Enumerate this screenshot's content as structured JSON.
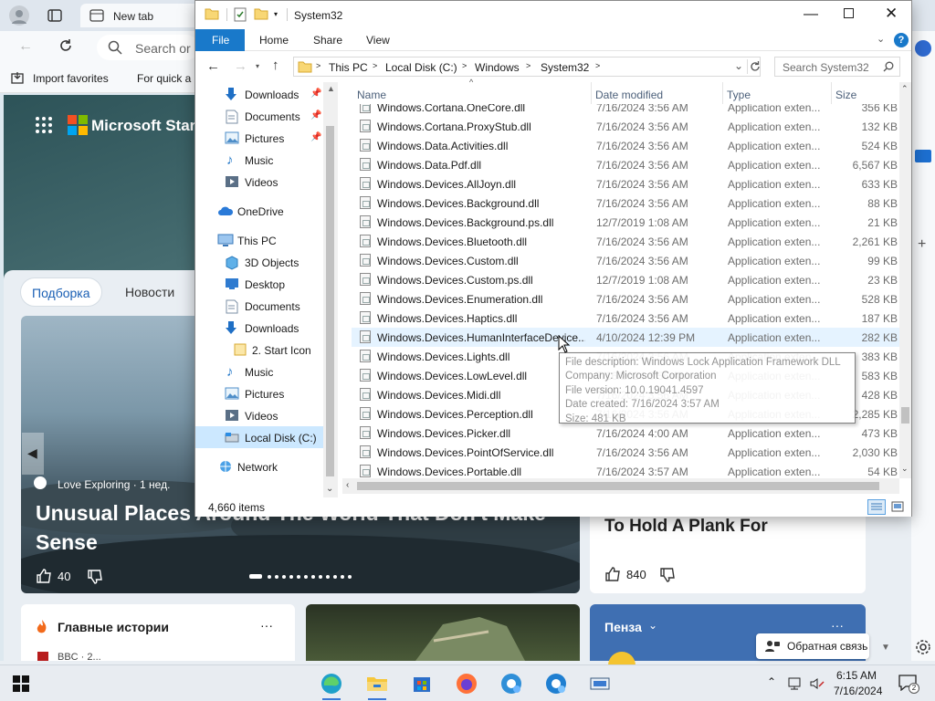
{
  "edge": {
    "tab_title": "New tab",
    "search_placeholder": "Search or",
    "favorites": [
      "Import favorites",
      "For quick a"
    ],
    "ms_start": "Microsoft Start",
    "pills": [
      "Подборка",
      "Новости"
    ],
    "big_card": {
      "source": "Love Exploring · 1 нед.",
      "title": "Unusual Places Around The World That Don't Make Sense",
      "likes": "40"
    },
    "right_card": {
      "title": "To Hold A Plank For",
      "likes": "840"
    },
    "stories_title": "Главные истории",
    "stories_more": "···",
    "stories_next": "BBC · 2...",
    "penza_title": "Пенза",
    "penza_more": "···",
    "feedback_label": "Обратная связь"
  },
  "explorer": {
    "title": "System32",
    "ribbon_tabs": [
      "File",
      "Home",
      "Share",
      "View"
    ],
    "breadcrumb": [
      "This PC",
      "Local Disk (C:)",
      "Windows",
      "System32"
    ],
    "search_placeholder": "Search System32",
    "nav": {
      "quick_access": [
        "Downloads",
        "Documents",
        "Pictures",
        "Music",
        "Videos"
      ],
      "onedrive": "OneDrive",
      "this_pc": "This PC",
      "this_pc_items": [
        "3D Objects",
        "Desktop",
        "Documents",
        "Downloads",
        "2. Start Icon",
        "Music",
        "Pictures",
        "Videos",
        "Local Disk (C:)"
      ],
      "network": "Network"
    },
    "columns": {
      "name": "Name",
      "date": "Date modified",
      "type": "Type",
      "size": "Size"
    },
    "files": [
      {
        "name": "Windows.Cortana.OneCore.dll",
        "date": "7/16/2024 3:56 AM",
        "type": "Application exten...",
        "size": "356 KB"
      },
      {
        "name": "Windows.Cortana.ProxyStub.dll",
        "date": "7/16/2024 3:56 AM",
        "type": "Application exten...",
        "size": "132 KB"
      },
      {
        "name": "Windows.Data.Activities.dll",
        "date": "7/16/2024 3:56 AM",
        "type": "Application exten...",
        "size": "524 KB"
      },
      {
        "name": "Windows.Data.Pdf.dll",
        "date": "7/16/2024 3:56 AM",
        "type": "Application exten...",
        "size": "6,567 KB"
      },
      {
        "name": "Windows.Devices.AllJoyn.dll",
        "date": "7/16/2024 3:56 AM",
        "type": "Application exten...",
        "size": "633 KB"
      },
      {
        "name": "Windows.Devices.Background.dll",
        "date": "7/16/2024 3:56 AM",
        "type": "Application exten...",
        "size": "88 KB"
      },
      {
        "name": "Windows.Devices.Background.ps.dll",
        "date": "12/7/2019 1:08 AM",
        "type": "Application exten...",
        "size": "21 KB"
      },
      {
        "name": "Windows.Devices.Bluetooth.dll",
        "date": "7/16/2024 3:56 AM",
        "type": "Application exten...",
        "size": "2,261 KB"
      },
      {
        "name": "Windows.Devices.Custom.dll",
        "date": "7/16/2024 3:56 AM",
        "type": "Application exten...",
        "size": "99 KB"
      },
      {
        "name": "Windows.Devices.Custom.ps.dll",
        "date": "12/7/2019 1:08 AM",
        "type": "Application exten...",
        "size": "23 KB"
      },
      {
        "name": "Windows.Devices.Enumeration.dll",
        "date": "7/16/2024 3:56 AM",
        "type": "Application exten...",
        "size": "528 KB"
      },
      {
        "name": "Windows.Devices.Haptics.dll",
        "date": "7/16/2024 3:56 AM",
        "type": "Application exten...",
        "size": "187 KB"
      },
      {
        "name": "Windows.Devices.HumanInterfaceDevice...",
        "date": "4/10/2024 12:39 PM",
        "type": "Application exten...",
        "size": "282 KB"
      },
      {
        "name": "Windows.Devices.Lights.dll",
        "date": "7/16/2024 3:56 AM",
        "type": "Application exten...",
        "size": "383 KB"
      },
      {
        "name": "Windows.Devices.LowLevel.dll",
        "date": "7/16/2024 3:56 AM",
        "type": "Application exten...",
        "size": "583 KB"
      },
      {
        "name": "Windows.Devices.Midi.dll",
        "date": "7/16/2024 3:56 AM",
        "type": "Application exten...",
        "size": "428 KB"
      },
      {
        "name": "Windows.Devices.Perception.dll",
        "date": "7/16/2024 3:56 AM",
        "type": "Application exten...",
        "size": "2,285 KB"
      },
      {
        "name": "Windows.Devices.Picker.dll",
        "date": "7/16/2024 4:00 AM",
        "type": "Application exten...",
        "size": "473 KB"
      },
      {
        "name": "Windows.Devices.PointOfService.dll",
        "date": "7/16/2024 3:56 AM",
        "type": "Application exten...",
        "size": "2,030 KB"
      },
      {
        "name": "Windows.Devices.Portable.dll",
        "date": "7/16/2024 3:57 AM",
        "type": "Application exten...",
        "size": "54 KB"
      }
    ],
    "tooltip": [
      "File description: Windows Lock Application Framework DLL",
      "Company: Microsoft Corporation",
      "File version: 10.0.19041.4597",
      "Date created: 7/16/2024 3:57 AM",
      "Size: 481 KB"
    ],
    "status": "4,660 items"
  },
  "taskbar": {
    "time": "6:15 AM",
    "date": "7/16/2024",
    "notification_count": "2"
  },
  "colors": {
    "accent": "#1979ca",
    "hover_row": "#e5f3ff",
    "selected_nav": "#cce8ff"
  }
}
